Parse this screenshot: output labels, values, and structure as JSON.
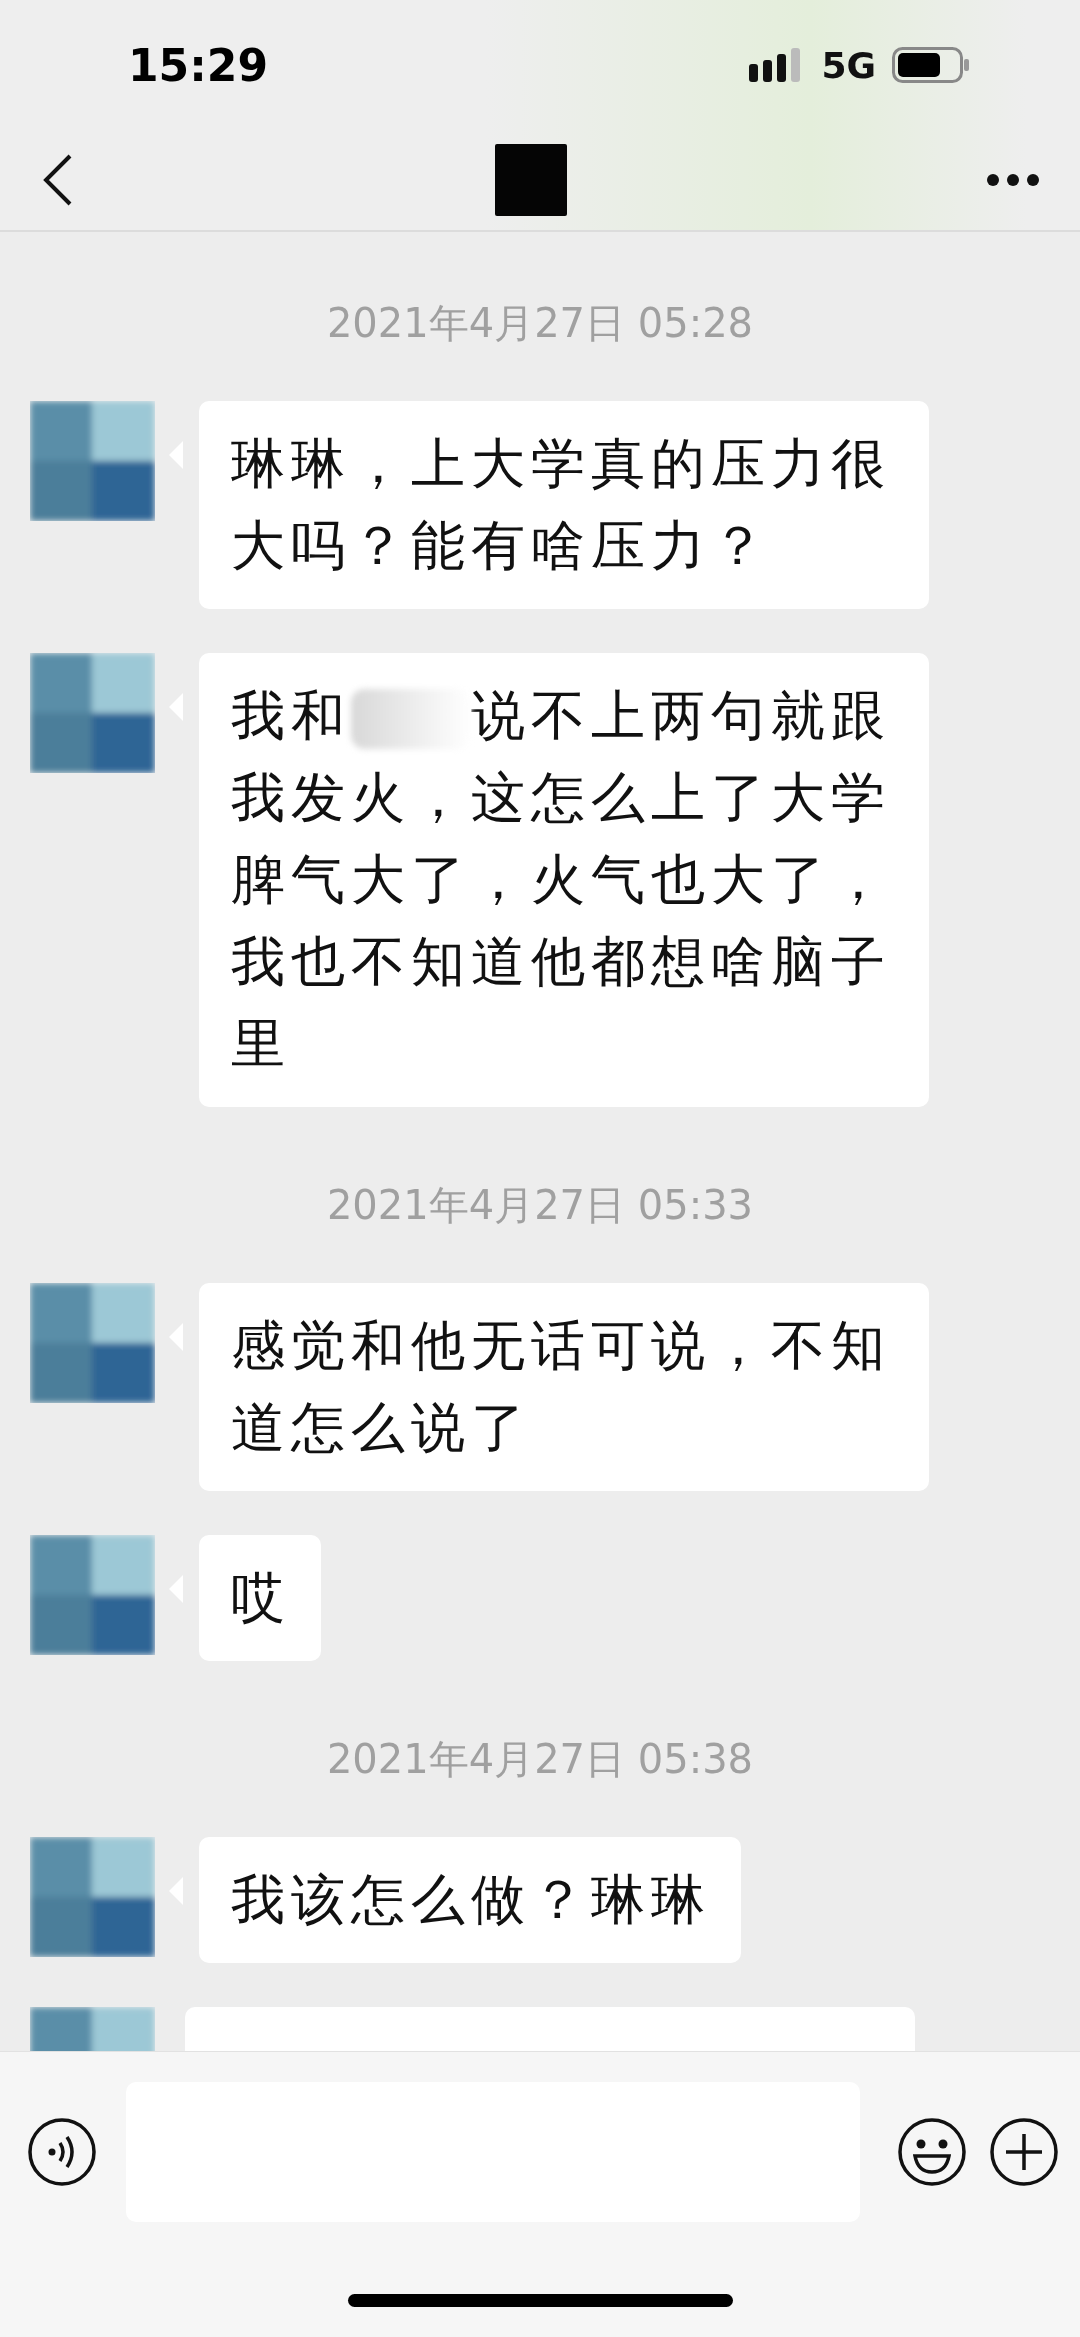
{
  "status_bar": {
    "time": "15:29",
    "network": "5G"
  },
  "messages": [
    {
      "kind": "timestamp",
      "text": "2021年4月27日 05:28"
    },
    {
      "kind": "message",
      "parts": [
        "琳琳，上大学真的压力很大吗？能有啥压力？"
      ]
    },
    {
      "kind": "message",
      "parts": [
        "我和",
        "说不上两句就跟我发火，这怎么上了大学脾气大了，火气也大了，我也不知道他都想啥脑子里"
      ]
    },
    {
      "kind": "timestamp",
      "text": "2021年4月27日 05:33"
    },
    {
      "kind": "message",
      "parts": [
        "感觉和他无话可说，不知道怎么说了"
      ]
    },
    {
      "kind": "message",
      "parts": [
        "哎"
      ]
    },
    {
      "kind": "timestamp",
      "text": "2021年4月27日 05:38"
    },
    {
      "kind": "message",
      "parts": [
        "我该怎么做？琳琳"
      ]
    },
    {
      "kind": "partial_message"
    }
  ]
}
